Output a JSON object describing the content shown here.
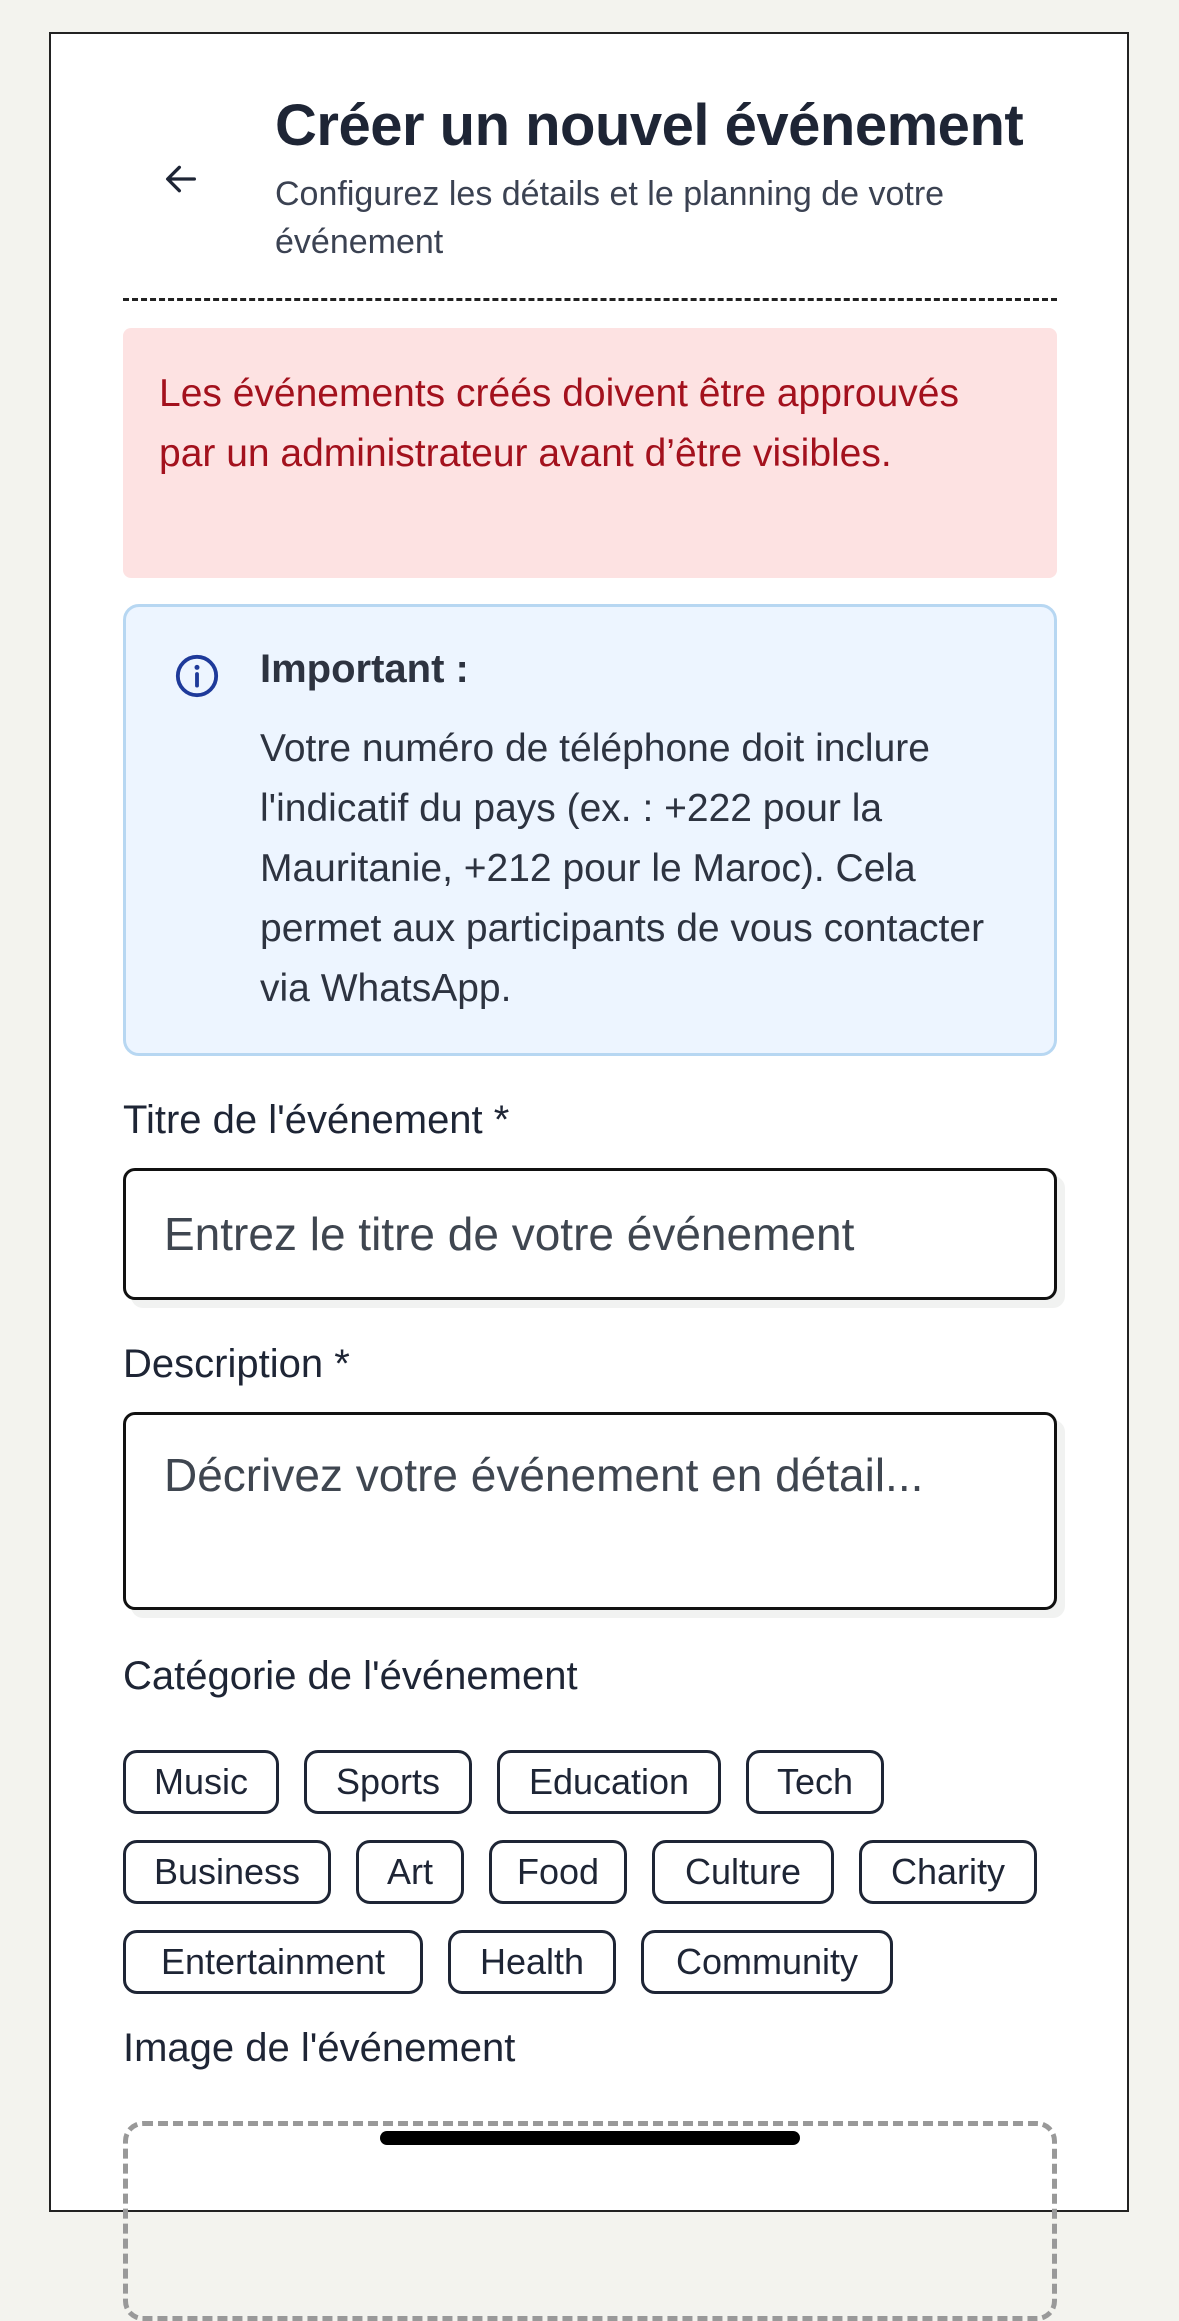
{
  "header": {
    "title": "Créer un nouvel événement",
    "subtitle": "Configurez les détails et le planning de votre événement"
  },
  "alerts": {
    "approval": "Les événements créés doivent être approuvés par un administrateur avant d’être visibles.",
    "info_title": "Important :",
    "info_body": "Votre numéro de téléphone doit inclure l'indicatif du pays (ex. : +222 pour la Mauritanie, +212 pour le Maroc). Cela permet aux participants de vous contacter via WhatsApp."
  },
  "form": {
    "title_label": "Titre de l'événement *",
    "title_placeholder": "Entrez le titre de votre événement",
    "description_label": "Description *",
    "description_placeholder": "Décrivez votre événement en détail...",
    "category_label": "Catégorie de l'événement",
    "categories": [
      "Music",
      "Sports",
      "Education",
      "Tech",
      "Business",
      "Art",
      "Food",
      "Culture",
      "Charity",
      "Entertainment",
      "Health",
      "Community"
    ],
    "image_label": "Image de l'événement"
  },
  "colors": {
    "alert_red_bg": "#fde2e2",
    "alert_red_text": "#a3111d",
    "alert_blue_bg": "#edf5ff",
    "alert_blue_border": "#b7d7f2",
    "info_icon": "#1e3a9a"
  }
}
